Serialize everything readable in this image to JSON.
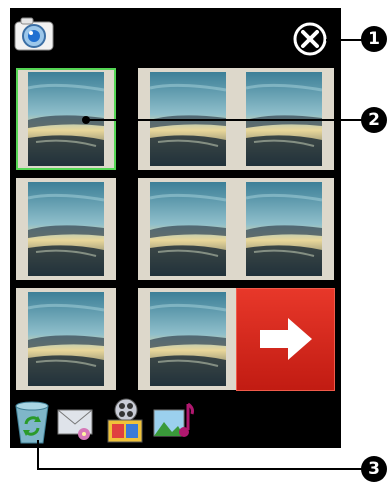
{
  "toolbar": {
    "camera_icon": "camera-icon",
    "close_icon": "close-icon"
  },
  "gallery": {
    "thumbnails": [
      {
        "selected": true
      },
      {
        "selected": false
      },
      {
        "selected": false
      },
      {
        "selected": false
      },
      {
        "selected": false
      },
      {
        "selected": false
      },
      {
        "selected": false
      },
      {
        "selected": false
      }
    ],
    "next_icon": "arrow-right-icon"
  },
  "bottom_tools": [
    {
      "icon": "recycle-bin-icon"
    },
    {
      "icon": "envelope-icon"
    },
    {
      "icon": "slideshow-icon"
    },
    {
      "icon": "picture-music-icon"
    }
  ],
  "callouts": {
    "close": "1",
    "thumbnail": "2",
    "recycle": "3"
  },
  "colors": {
    "screen_bg": "#000000",
    "selection": "#55d655",
    "next_button": "#d82a1e"
  }
}
